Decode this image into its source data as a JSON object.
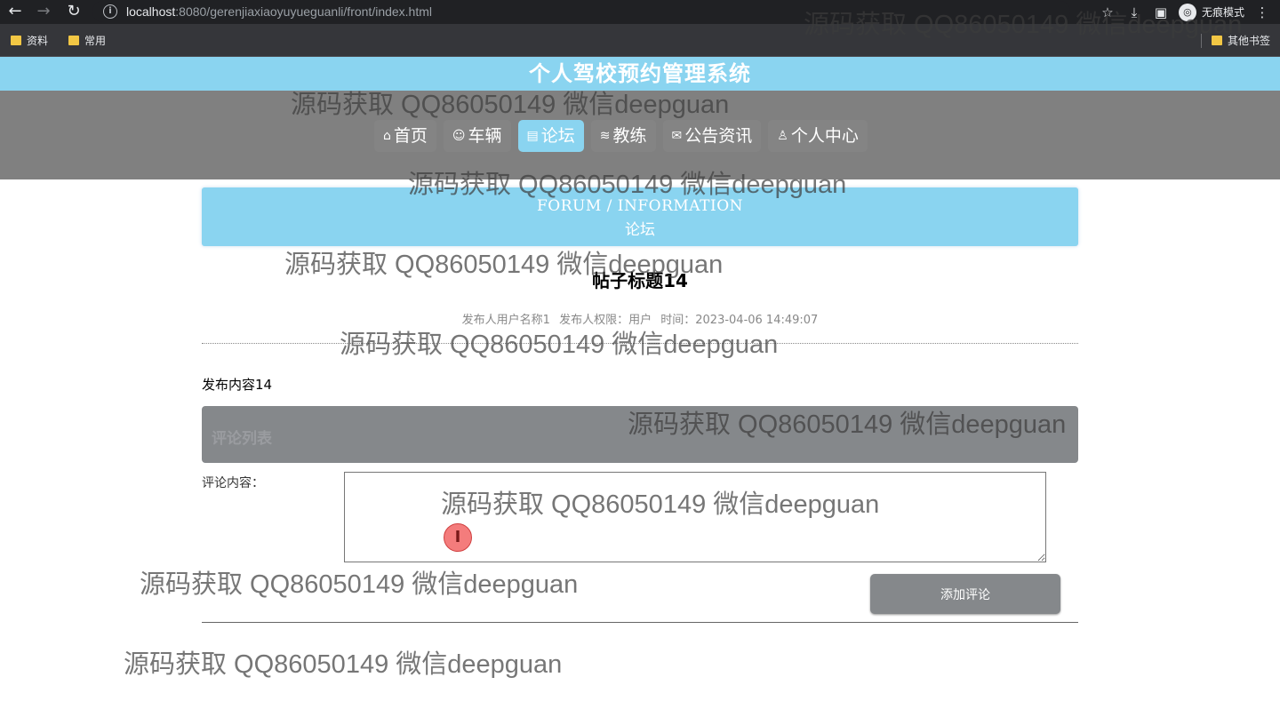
{
  "browser": {
    "url_host": "localhost",
    "url_rest": ":8080/gerenjiaxiaoyuyueguanli/front/index.html",
    "incognito_label": "无痕模式",
    "bookmarks": [
      "资料",
      "常用"
    ],
    "other_bookmarks": "其他书签"
  },
  "site": {
    "title": "个人驾校预约管理系统",
    "nav": [
      {
        "label": "首页",
        "icon": "home-icon",
        "glyph": "⌂"
      },
      {
        "label": "车辆",
        "icon": "car-icon",
        "glyph": "☺"
      },
      {
        "label": "论坛",
        "icon": "forum-icon",
        "glyph": "▤"
      },
      {
        "label": "教练",
        "icon": "layers-icon",
        "glyph": "≋"
      },
      {
        "label": "公告资讯",
        "icon": "mail-icon",
        "glyph": "✉"
      },
      {
        "label": "个人中心",
        "icon": "user-icon",
        "glyph": "♙"
      }
    ],
    "active_nav": "论坛"
  },
  "banner": {
    "en": "FORUM / INFORMATION",
    "cn": "论坛"
  },
  "post": {
    "title": "帖子标题14",
    "author": "发布人用户名称1",
    "role": "发布人权限：用户",
    "time": "时间：2023-04-06 14:49:07",
    "content": "发布内容14"
  },
  "comments": {
    "header": "评论列表",
    "input_label": "评论内容：",
    "input_value": "",
    "submit_label": "添加评论"
  },
  "watermark": "源码获取 QQ86050149 微信deepguan",
  "colors": {
    "accent": "#8ad4f0",
    "nav_bg": "#808080",
    "button_gray": "#85888b"
  }
}
